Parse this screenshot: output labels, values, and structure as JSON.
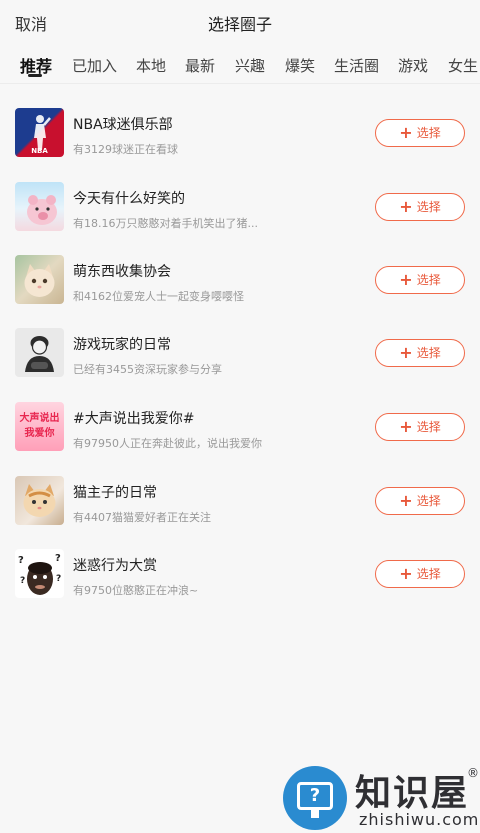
{
  "header": {
    "cancel_label": "取消",
    "title": "选择圈子"
  },
  "tabs": [
    {
      "label": "推荐",
      "active": true
    },
    {
      "label": "已加入"
    },
    {
      "label": "本地"
    },
    {
      "label": "最新"
    },
    {
      "label": "兴趣"
    },
    {
      "label": "爆笑"
    },
    {
      "label": "生活圈"
    },
    {
      "label": "游戏"
    },
    {
      "label": "女生"
    }
  ],
  "circles": [
    {
      "name": "NBA球迷俱乐部",
      "desc": "有3129球迷正在看球",
      "button": "选择",
      "avatar_text": "NBA"
    },
    {
      "name": "今天有什么好笑的",
      "desc": "有18.16万只憨憨对着手机笑出了猪...",
      "button": "选择"
    },
    {
      "name": "萌东西收集协会",
      "desc": "和4162位爱宠人士一起变身嘤嘤怪",
      "button": "选择"
    },
    {
      "name": "游戏玩家的日常",
      "desc": "已经有3455资深玩家参与分享",
      "button": "选择"
    },
    {
      "name": "#大声说出我爱你#",
      "desc": "有97950人正在奔赴彼此，说出我爱你",
      "button": "选择",
      "avatar_text": "大声说出我爱你"
    },
    {
      "name": "猫主子的日常",
      "desc": "有4407猫猫爱好者正在关注",
      "button": "选择"
    },
    {
      "name": "迷惑行为大赏",
      "desc": "有9750位憨憨正在冲浪~",
      "button": "选择"
    }
  ],
  "watermark": {
    "brand": "知识屋",
    "url": "zhishiwu.com",
    "reg": "®"
  },
  "colors": {
    "accent": "#e8583a",
    "background": "#f7f7f7"
  }
}
